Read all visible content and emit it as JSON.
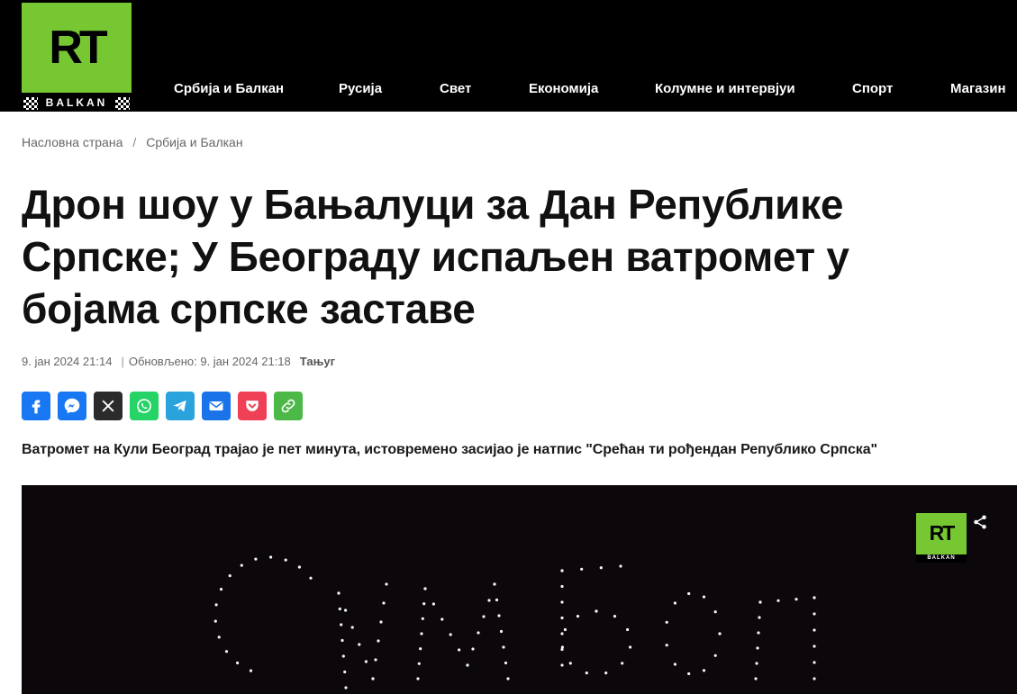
{
  "header": {
    "logo": {
      "mark": "RT",
      "sub": "BALKAN"
    },
    "nav": [
      {
        "label": "Србија и Балкан"
      },
      {
        "label": "Русија"
      },
      {
        "label": "Свет"
      },
      {
        "label": "Економија"
      },
      {
        "label": "Колумне и интервјуи"
      },
      {
        "label": "Спорт"
      },
      {
        "label": "Магазин"
      }
    ]
  },
  "breadcrumb": {
    "home": "Насловна страна",
    "separator": "/",
    "section": "Србија и Балкан"
  },
  "article": {
    "title": "Дрон шоу у Бањалуци за Дан Републике Српске; У Београду испаљен ватромет у бојама српске заставе",
    "published": "9. јан 2024 21:14",
    "updated_divider": "|",
    "updated": "Обновљено: 9. јан 2024 21:18",
    "source": "Тањуг",
    "lead": "Ватромет на Кули Београд трајао је пет минута, истовремено засијао је натпис \"Срећан ти рођендан Републико Српска\""
  },
  "share_buttons": [
    {
      "name": "facebook-icon",
      "color": "#1877f2"
    },
    {
      "name": "messenger-icon",
      "color": "#1877f2"
    },
    {
      "name": "x-icon",
      "color": "#2b2b2b"
    },
    {
      "name": "whatsapp-icon",
      "color": "#25d366"
    },
    {
      "name": "telegram-icon",
      "color": "#2aa3dc"
    },
    {
      "name": "email-icon",
      "color": "#1a73e8"
    },
    {
      "name": "pocket-icon",
      "color": "#ef4056"
    },
    {
      "name": "link-icon",
      "color": "#4cb848"
    }
  ],
  "media": {
    "watermark": {
      "mark": "RT",
      "sub": "BALKAN"
    },
    "share_icon": "share-icon",
    "colors": {
      "background": "#0c070b",
      "drone": "#ffffff"
    }
  },
  "colors": {
    "brand": "#77c733",
    "header_bg": "#000000"
  }
}
